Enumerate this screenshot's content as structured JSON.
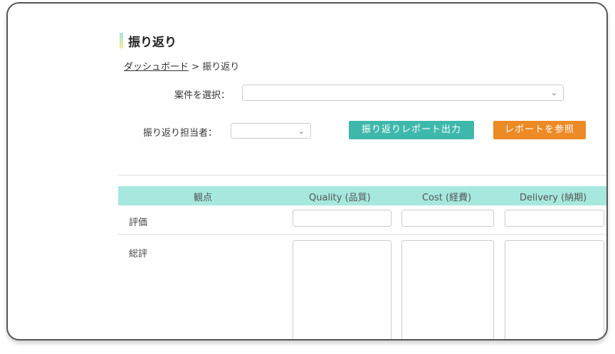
{
  "page": {
    "title": "振り返り",
    "breadcrumb": {
      "link": "ダッシュボード",
      "separator": ">",
      "current": "振り返り"
    }
  },
  "form": {
    "project_label": "案件を選択：",
    "project_value": "",
    "reviewer_label": "振り返り担当者：",
    "reviewer_value": "",
    "export_button": "振り返りレポート出力",
    "view_report_button": "レポートを参照"
  },
  "table": {
    "headers": [
      "観点",
      "Quality (品質)",
      "Cost (経費)",
      "Delivery (納期)"
    ],
    "rows": [
      "評価",
      "総評"
    ]
  },
  "colors": {
    "accent_teal": "#3fb8ac",
    "accent_orange": "#ec8a25",
    "header_bg": "#a6e8de"
  },
  "icons": {
    "dropdown": "chevron-down-icon"
  }
}
